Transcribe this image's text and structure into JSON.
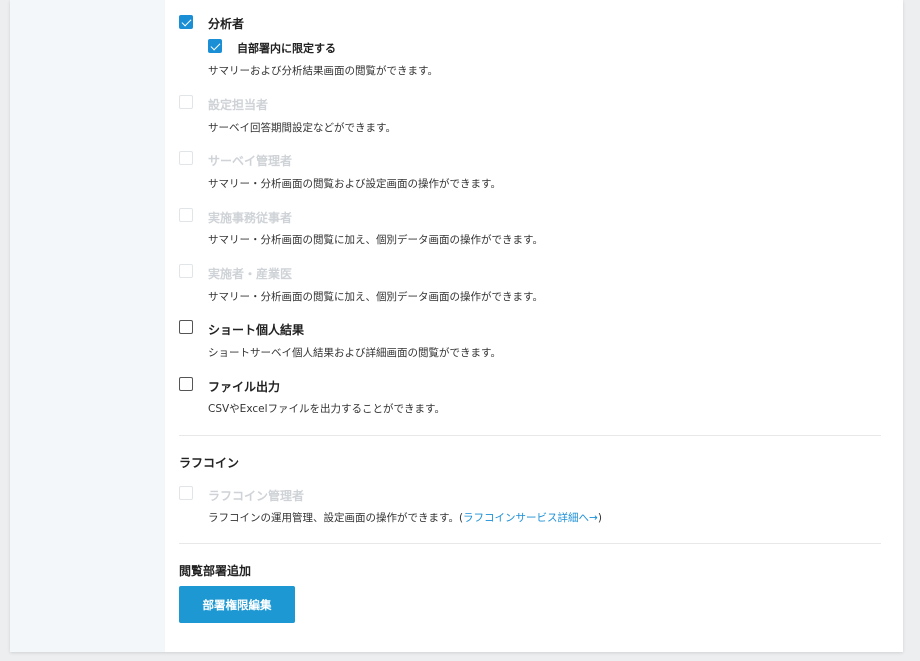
{
  "roles": {
    "analyst": {
      "label": "分析者",
      "checked": true,
      "sub_option": {
        "label": "自部署内に限定する",
        "checked": true
      },
      "description": "サマリーおよび分析結果画面の閲覧ができます。"
    },
    "settings_manager": {
      "label": "設定担当者",
      "disabled": true,
      "description": "サーベイ回答期間設定などができます。"
    },
    "survey_admin": {
      "label": "サーベイ管理者",
      "disabled": true,
      "description": "サマリー・分析画面の閲覧および設定画面の操作ができます。"
    },
    "implementation_staff": {
      "label": "実施事務従事者",
      "disabled": true,
      "description": "サマリー・分析画面の閲覧に加え、個別データ画面の操作ができます。"
    },
    "implementer_physician": {
      "label": "実施者・産業医",
      "disabled": true,
      "description": "サマリー・分析画面の閲覧に加え、個別データ画面の操作ができます。"
    },
    "short_individual_results": {
      "label": "ショート個人結果",
      "checked": false,
      "description": "ショートサーベイ個人結果および詳細画面の閲覧ができます。"
    },
    "file_output": {
      "label": "ファイル出力",
      "checked": false,
      "description": "CSVやExcelファイルを出力することができます。"
    }
  },
  "rafcoin": {
    "section_title": "ラフコイン",
    "admin": {
      "label": "ラフコイン管理者",
      "disabled": true,
      "description_prefix": "ラフコインの運用管理、設定画面の操作ができます。(",
      "link_text": "ラフコインサービス詳細へ→",
      "description_suffix": ")"
    }
  },
  "view_department": {
    "section_title": "閲覧部署追加",
    "edit_button_label": "部署権限編集"
  },
  "colors": {
    "accent": "#1a8fd6",
    "button": "#1d98d3",
    "disabled_text": "#cfd3d7"
  }
}
